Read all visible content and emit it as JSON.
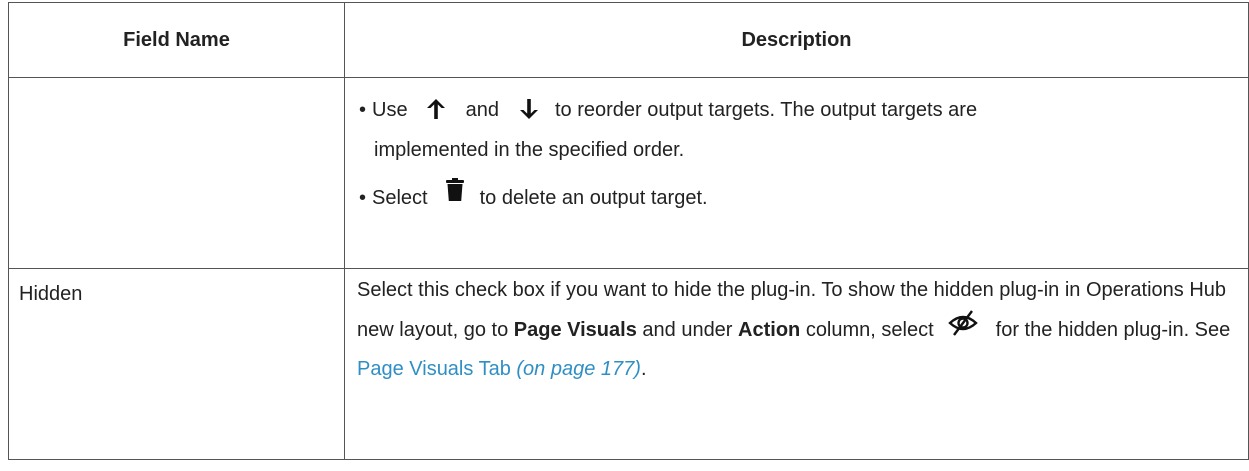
{
  "table": {
    "headers": {
      "field_name": "Field Name",
      "description": "Description"
    },
    "row1": {
      "field_name": "",
      "bullet1": {
        "use": "Use",
        "and": "and",
        "rest": "to reorder output targets. The output targets are",
        "line2": "implemented in the specified order."
      },
      "bullet2": {
        "select": "Select",
        "rest": "to delete an output target."
      }
    },
    "row2": {
      "field_name": "Hidden",
      "part1": "Select this check box if you want to hide the plug-in. To show the hidden plug-in in Operations Hub new layout, go to",
      "page_visuals": "Page Visuals",
      "and_under": "and under",
      "action": "Action",
      "column_select": "column, select",
      "for_hidden": "for the hidden plug-in. See",
      "link_text": "Page Visuals Tab",
      "link_page": "(on page 177)",
      "period": "."
    }
  },
  "icons": {
    "up": "arrow-up-icon",
    "down": "arrow-down-icon",
    "trash": "trash-icon",
    "eye": "eye-slash-icon"
  },
  "colors": {
    "link": "#2f8fc4",
    "border": "#555555",
    "text": "#222222"
  }
}
